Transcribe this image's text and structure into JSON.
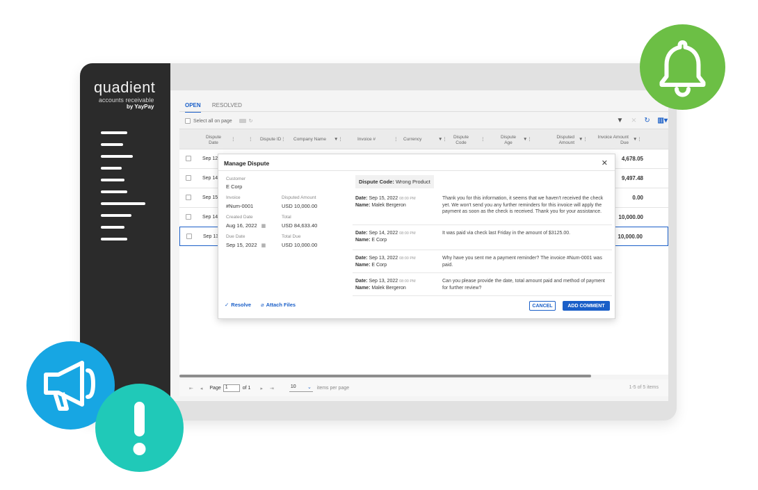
{
  "brand": {
    "name": "quadient",
    "product": "accounts receivable",
    "by": "by YayPay"
  },
  "tabs": [
    {
      "label": "OPEN",
      "active": true
    },
    {
      "label": "RESOLVED",
      "active": false
    }
  ],
  "toolbar": {
    "select_all_label": "Select all on page"
  },
  "grid": {
    "headers": [
      "Dispute Date",
      "Dispute ID",
      "Company Name",
      "Invoice #",
      "Currency",
      "Dispute Code",
      "Dispute Age",
      "Disputed Amount",
      "Invoice Amount Due"
    ],
    "rows": [
      {
        "date": "Sep 12,",
        "amount": "4,678.05"
      },
      {
        "date": "Sep 14,",
        "amount": "9,497.48"
      },
      {
        "date": "Sep 15,",
        "amount": "0.00"
      },
      {
        "date": "Sep 14,",
        "amount": "10,000.00"
      },
      {
        "date": "Sep 13,",
        "amount": "10,000.00"
      }
    ]
  },
  "pager": {
    "page_label": "Page",
    "page_value": "1",
    "of_label": "of 1",
    "per_page_value": "10",
    "per_page_label": "items per page",
    "summary": "1-5 of 5 items"
  },
  "modal": {
    "title": "Manage Dispute",
    "customer_label": "Customer",
    "customer_value": "E Corp",
    "invoice_label": "Invoice",
    "invoice_value": "#Num-0001",
    "disputed_amount_label": "Disputed Amount",
    "disputed_amount_value": "USD 10,000.00",
    "created_date_label": "Created Date",
    "created_date_value": "Aug 16, 2022",
    "total_label": "Total",
    "total_value": "USD 84,633.40",
    "due_date_label": "Due Date",
    "due_date_value": "Sep 15, 2022",
    "total_due_label": "Total Due",
    "total_due_value": "USD 10,000.00",
    "dispute_code_label": "Dispute Code:",
    "dispute_code_value": "Wrong Product",
    "resolve_label": "Resolve",
    "attach_label": "Attach Files",
    "cancel_label": "CANCEL",
    "add_comment_label": "ADD COMMENT",
    "date_label": "Date:",
    "name_label": "Name:",
    "comments": [
      {
        "date": "Sep 15, 2022",
        "time": "08:00 PM",
        "name": "Malek Bergeron",
        "text": "Thank you for this information, it seems that we haven't received the check yet. We won't send you any further reminders for this invoice will apply the payment as soon as the check is received. Thank you for your assistance."
      },
      {
        "date": "Sep 14, 2022",
        "time": "08:00 PM",
        "name": "E Corp",
        "text": "It was paid via check last Friday in the amount of $3125.00."
      },
      {
        "date": "Sep 13, 2022",
        "time": "08:00 PM",
        "name": "E Corp",
        "text": "Why have you sent me a payment reminder? The invoice #Num-0001 was paid."
      },
      {
        "date": "Sep 13, 2022",
        "time": "08:00 PM",
        "name": "Malek Bergeron",
        "text": "Can you please provide the date, total amount paid and method of payment for further review?"
      }
    ]
  },
  "colors": {
    "accent": "#1a5fc8",
    "bell": "#6cbf45",
    "megaphone": "#17a6e3",
    "alert": "#20c9b8"
  }
}
